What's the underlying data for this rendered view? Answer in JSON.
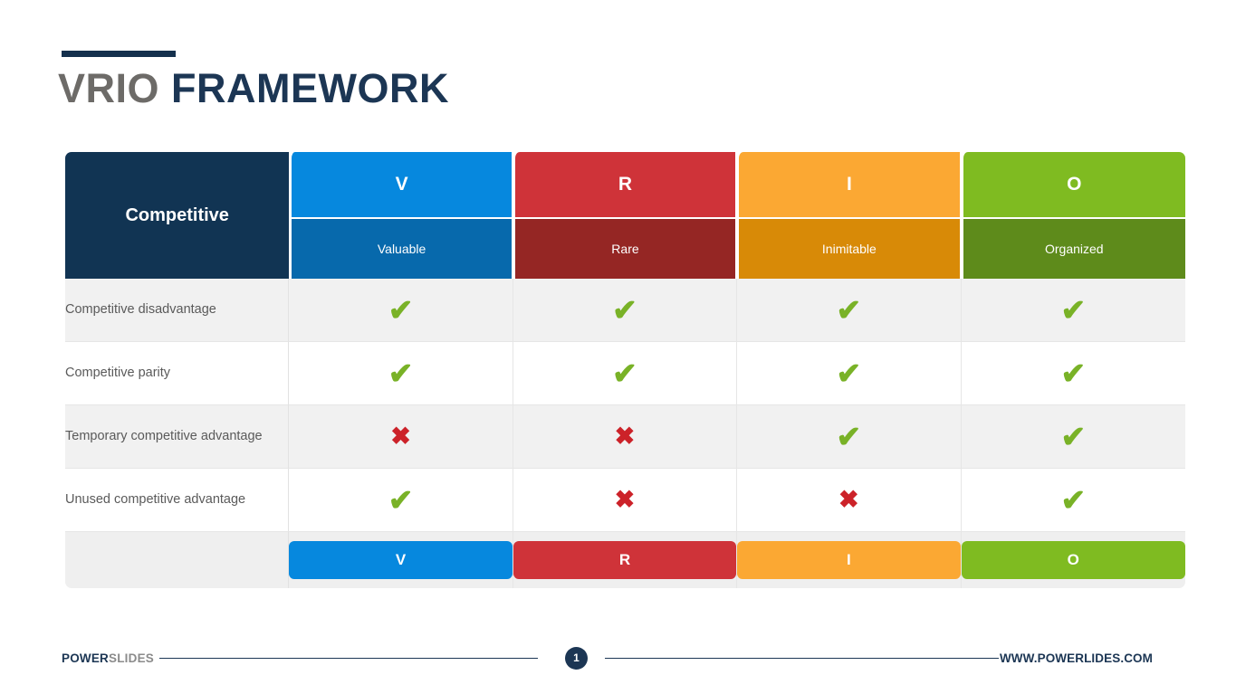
{
  "title": {
    "part1": "VRIO",
    "part2": "FRAMEWORK",
    "accent_color": "#14304d",
    "part1_color": "#6d6b68",
    "part2_color": "#1c3654"
  },
  "table": {
    "corner_header": "Competitive",
    "columns": [
      {
        "letter": "V",
        "word": "Valuable",
        "color": "#0688de",
        "dark_color": "#0769ac"
      },
      {
        "letter": "R",
        "word": "Rare",
        "color": "#cf3339",
        "dark_color": "#952624"
      },
      {
        "letter": "I",
        "word": "Inimitable",
        "color": "#fba833",
        "dark_color": "#d88a07"
      },
      {
        "letter": "O",
        "word": "Organized",
        "color": "#7fbb21",
        "dark_color": "#5e8b1b"
      }
    ],
    "rows": [
      {
        "label": "Competitive disadvantage",
        "marks": [
          "check",
          "check",
          "check",
          "check"
        ]
      },
      {
        "label": "Competitive parity",
        "marks": [
          "check",
          "check",
          "check",
          "check"
        ]
      },
      {
        "label": "Temporary competitive advantage",
        "marks": [
          "cross",
          "cross",
          "check",
          "check"
        ]
      },
      {
        "label": "Unused competitive advantage",
        "marks": [
          "check",
          "cross",
          "cross",
          "check"
        ]
      }
    ],
    "footer_buttons": [
      "V",
      "R",
      "I",
      "O"
    ],
    "marks": {
      "check_glyph": "✔",
      "cross_glyph": "✖",
      "check_color": "#79b227",
      "cross_color": "#cc2229"
    }
  },
  "footer": {
    "brand_part1": "POWER",
    "brand_part2": "SLIDES",
    "page_number": "1",
    "url": "WWW.POWERLIDES.COM"
  }
}
